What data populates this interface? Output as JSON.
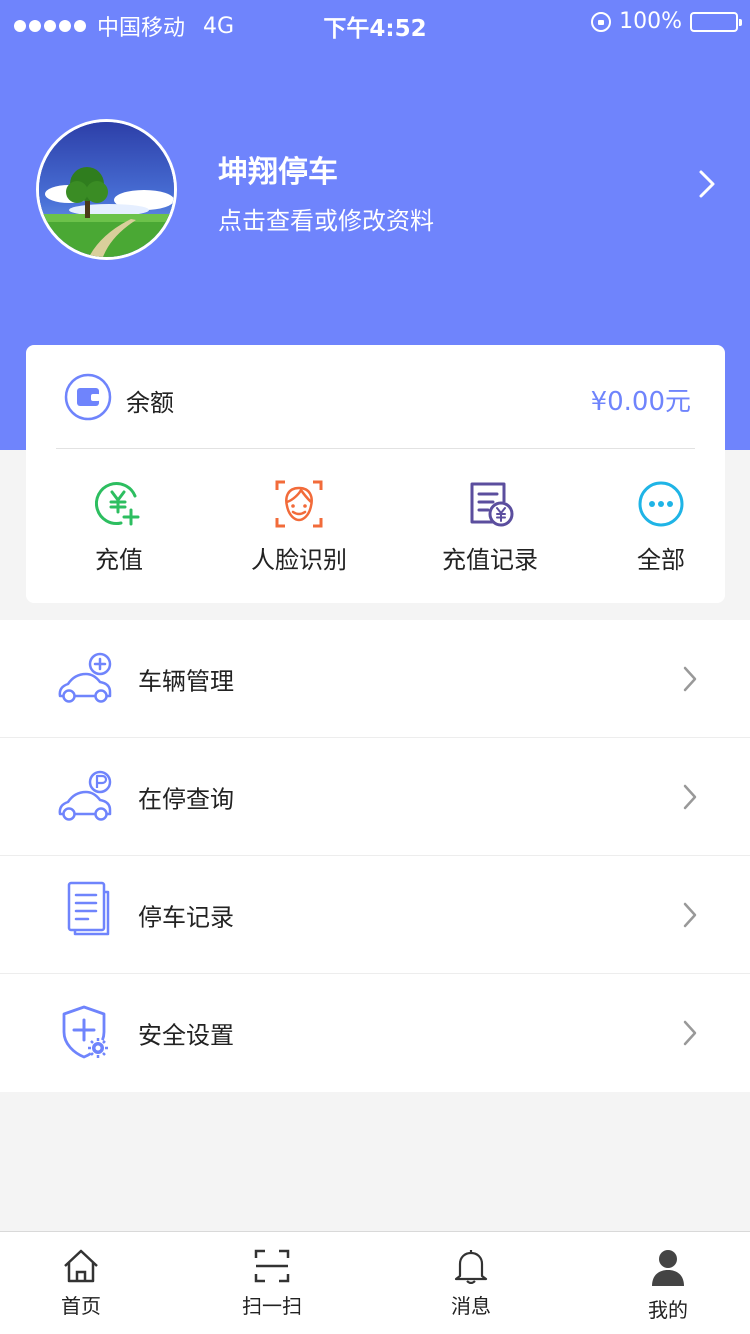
{
  "status_bar": {
    "signal_dots": "●●●●●",
    "carrier": "中国移动",
    "network": "4G",
    "time": "下午4:52",
    "battery": "100%"
  },
  "profile": {
    "name": "坤翔停车",
    "subtitle": "点击查看或修改资料"
  },
  "balance": {
    "label": "余额",
    "value": "¥0.00元"
  },
  "quick_actions": [
    {
      "label": "充值",
      "icon": "recharge-icon"
    },
    {
      "label": "人脸识别",
      "icon": "face-recognition-icon"
    },
    {
      "label": "充值记录",
      "icon": "recharge-record-icon"
    },
    {
      "label": "全部",
      "icon": "more-icon"
    }
  ],
  "menu": [
    {
      "label": "车辆管理",
      "icon": "car-add-icon"
    },
    {
      "label": "在停查询",
      "icon": "car-parking-icon"
    },
    {
      "label": "停车记录",
      "icon": "document-icon"
    },
    {
      "label": "安全设置",
      "icon": "shield-settings-icon"
    }
  ],
  "tabs": [
    {
      "label": "首页",
      "icon": "home-icon"
    },
    {
      "label": "扫一扫",
      "icon": "scan-icon"
    },
    {
      "label": "消息",
      "icon": "bell-icon"
    },
    {
      "label": "我的",
      "icon": "user-icon"
    }
  ],
  "colors": {
    "brand": "#6f84fc",
    "green": "#2dbe60",
    "orange": "#f26b3a",
    "purple": "#5b4e9e",
    "cyan": "#1fb4e6"
  }
}
